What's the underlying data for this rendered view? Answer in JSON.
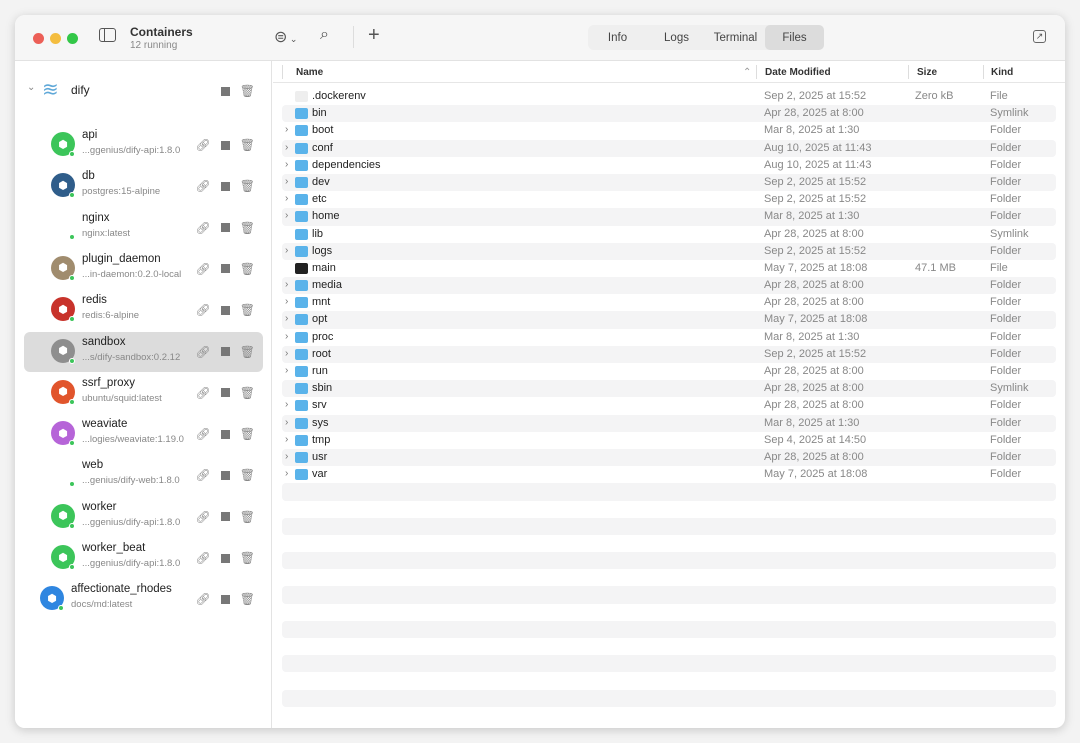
{
  "window": {
    "title": "Containers",
    "subtitle": "12 running"
  },
  "tabs": [
    {
      "label": "Info"
    },
    {
      "label": "Logs"
    },
    {
      "label": "Terminal"
    },
    {
      "label": "Files",
      "active": true
    }
  ],
  "group": {
    "name": "dify"
  },
  "containers": [
    {
      "name": "api",
      "image": "...ggenius/dify-api:1.8.0",
      "color": "#3cc55a"
    },
    {
      "name": "db",
      "image": "postgres:15-alpine",
      "color": "#2f5d8a"
    },
    {
      "name": "nginx",
      "image": "nginx:latest",
      "color": "#ffffff",
      "logo": "NGINX"
    },
    {
      "name": "plugin_daemon",
      "image": "...in-daemon:0.2.0-local",
      "color": "#a08c6e"
    },
    {
      "name": "redis",
      "image": "redis:6-alpine",
      "color": "#c8332b"
    },
    {
      "name": "sandbox",
      "image": "...s/dify-sandbox:0.2.12",
      "color": "#8e8e8e",
      "selected": true
    },
    {
      "name": "ssrf_proxy",
      "image": "ubuntu/squid:latest",
      "color": "#e1552c"
    },
    {
      "name": "weaviate",
      "image": "...logies/weaviate:1.19.0",
      "color": "#b664d8"
    },
    {
      "name": "web",
      "image": "...genius/dify-web:1.8.0",
      "color": "#ffffff"
    },
    {
      "name": "worker",
      "image": "...ggenius/dify-api:1.8.0",
      "color": "#3cc55a"
    },
    {
      "name": "worker_beat",
      "image": "...ggenius/dify-api:1.8.0",
      "color": "#3cc55a"
    }
  ],
  "standalone": {
    "name": "affectionate_rhodes",
    "image": "docs/md:latest",
    "color": "#2f86e0"
  },
  "columns": {
    "name": "Name",
    "date": "Date Modified",
    "size": "Size",
    "kind": "Kind"
  },
  "files": [
    {
      "name": ".dockerenv",
      "date": "Sep 2, 2025 at 15:52",
      "size": "Zero kB",
      "kind": "File",
      "icon": "file"
    },
    {
      "name": "bin",
      "date": "Apr 28, 2025 at 8:00",
      "size": "",
      "kind": "Symlink",
      "icon": "folder"
    },
    {
      "name": "boot",
      "date": "Mar 8, 2025 at 1:30",
      "size": "",
      "kind": "Folder",
      "icon": "folder"
    },
    {
      "name": "conf",
      "date": "Aug 10, 2025 at 11:43",
      "size": "",
      "kind": "Folder",
      "icon": "folder"
    },
    {
      "name": "dependencies",
      "date": "Aug 10, 2025 at 11:43",
      "size": "",
      "kind": "Folder",
      "icon": "folder"
    },
    {
      "name": "dev",
      "date": "Sep 2, 2025 at 15:52",
      "size": "",
      "kind": "Folder",
      "icon": "folder"
    },
    {
      "name": "etc",
      "date": "Sep 2, 2025 at 15:52",
      "size": "",
      "kind": "Folder",
      "icon": "folder"
    },
    {
      "name": "home",
      "date": "Mar 8, 2025 at 1:30",
      "size": "",
      "kind": "Folder",
      "icon": "folder"
    },
    {
      "name": "lib",
      "date": "Apr 28, 2025 at 8:00",
      "size": "",
      "kind": "Symlink",
      "icon": "folder"
    },
    {
      "name": "logs",
      "date": "Sep 2, 2025 at 15:52",
      "size": "",
      "kind": "Folder",
      "icon": "folder"
    },
    {
      "name": "main",
      "date": "May 7, 2025 at 18:08",
      "size": "47.1 MB",
      "kind": "File",
      "icon": "exe"
    },
    {
      "name": "media",
      "date": "Apr 28, 2025 at 8:00",
      "size": "",
      "kind": "Folder",
      "icon": "folder"
    },
    {
      "name": "mnt",
      "date": "Apr 28, 2025 at 8:00",
      "size": "",
      "kind": "Folder",
      "icon": "folder"
    },
    {
      "name": "opt",
      "date": "May 7, 2025 at 18:08",
      "size": "",
      "kind": "Folder",
      "icon": "folder"
    },
    {
      "name": "proc",
      "date": "Mar 8, 2025 at 1:30",
      "size": "",
      "kind": "Folder",
      "icon": "folder"
    },
    {
      "name": "root",
      "date": "Sep 2, 2025 at 15:52",
      "size": "",
      "kind": "Folder",
      "icon": "folder"
    },
    {
      "name": "run",
      "date": "Apr 28, 2025 at 8:00",
      "size": "",
      "kind": "Folder",
      "icon": "folder"
    },
    {
      "name": "sbin",
      "date": "Apr 28, 2025 at 8:00",
      "size": "",
      "kind": "Symlink",
      "icon": "folder"
    },
    {
      "name": "srv",
      "date": "Apr 28, 2025 at 8:00",
      "size": "",
      "kind": "Folder",
      "icon": "folder"
    },
    {
      "name": "sys",
      "date": "Mar 8, 2025 at 1:30",
      "size": "",
      "kind": "Folder",
      "icon": "folder"
    },
    {
      "name": "tmp",
      "date": "Sep 4, 2025 at 14:50",
      "size": "",
      "kind": "Folder",
      "icon": "folder"
    },
    {
      "name": "usr",
      "date": "Apr 28, 2025 at 8:00",
      "size": "",
      "kind": "Folder",
      "icon": "folder"
    },
    {
      "name": "var",
      "date": "May 7, 2025 at 18:08",
      "size": "",
      "kind": "Folder",
      "icon": "folder"
    }
  ]
}
